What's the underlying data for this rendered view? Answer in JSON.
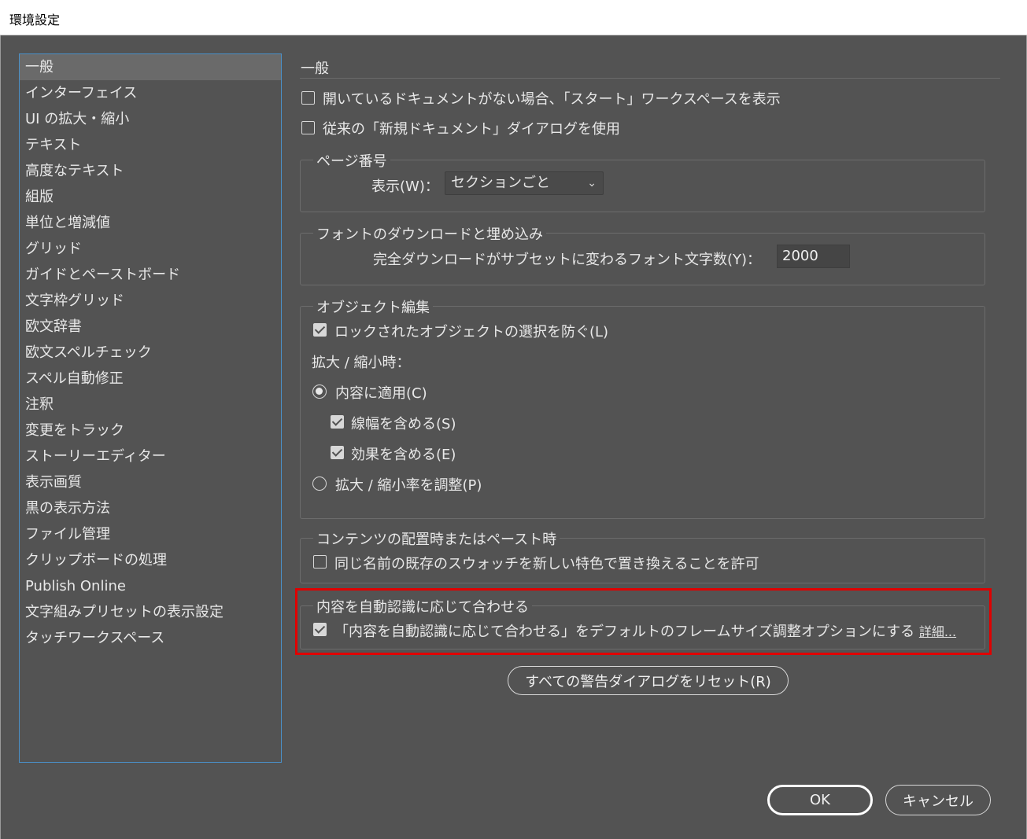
{
  "window": {
    "title": "環境設定"
  },
  "sidebar": {
    "items": [
      {
        "label": "一般"
      },
      {
        "label": "インターフェイス"
      },
      {
        "label": "UI の拡大・縮小"
      },
      {
        "label": "テキスト"
      },
      {
        "label": "高度なテキスト"
      },
      {
        "label": "組版"
      },
      {
        "label": "単位と増減値"
      },
      {
        "label": "グリッド"
      },
      {
        "label": "ガイドとペーストボード"
      },
      {
        "label": "文字枠グリッド"
      },
      {
        "label": "欧文辞書"
      },
      {
        "label": "欧文スペルチェック"
      },
      {
        "label": "スペル自動修正"
      },
      {
        "label": "注釈"
      },
      {
        "label": "変更をトラック"
      },
      {
        "label": "ストーリーエディター"
      },
      {
        "label": "表示画質"
      },
      {
        "label": "黒の表示方法"
      },
      {
        "label": "ファイル管理"
      },
      {
        "label": "クリップボードの処理"
      },
      {
        "label": "Publish Online"
      },
      {
        "label": "文字組みプリセットの表示設定"
      },
      {
        "label": "タッチワークスペース"
      }
    ],
    "selected": "一般"
  },
  "main": {
    "heading": "一般",
    "option_start_workspace": "開いているドキュメントがない場合、「スタート」ワークスペースを表示",
    "option_legacy_new_doc": "従来の「新規ドキュメント」ダイアログを使用",
    "page_number": {
      "title": "ページ番号",
      "view_label": "表示(W)：",
      "view_value": "セクションごと"
    },
    "font_download": {
      "title": "フォントのダウンロードと埋め込み",
      "subset_label": "完全ダウンロードがサブセットに変わるフォント文字数(Y)：",
      "subset_value": "2000"
    },
    "object_edit": {
      "title": "オブジェクト編集",
      "prevent_locked": "ロックされたオブジェクトの選択を防ぐ(L)",
      "scale_label": "拡大 / 縮小時：",
      "apply_content": "内容に適用(C)",
      "include_stroke": "線幅を含める(S)",
      "include_effects": "効果を含める(E)",
      "adjust_scale": "拡大 / 縮小率を調整(P)"
    },
    "content_placement": {
      "title": "コンテンツの配置時またはペースト時",
      "swatch_option": "同じ名前の既存のスウォッチを新しい特色で置き換えることを許可"
    },
    "content_aware": {
      "title": "内容を自動認識に応じて合わせる",
      "default_option": "「内容を自動認識に応じて合わせる」をデフォルトのフレームサイズ調整オプションにする",
      "details_link": "詳細..."
    },
    "reset_warnings": "すべての警告ダイアログをリセット(R)"
  },
  "footer": {
    "ok": "OK",
    "cancel": "キャンセル"
  },
  "colors": {
    "background": "#535353",
    "highlight": "#e00000",
    "sidebar_border": "#4a90c8"
  }
}
